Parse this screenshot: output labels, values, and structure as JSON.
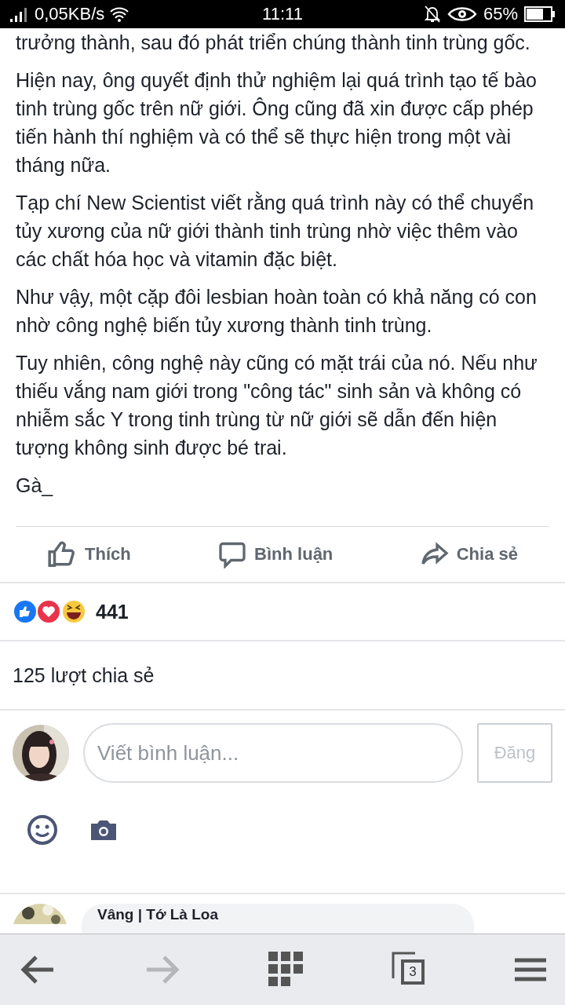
{
  "status_bar": {
    "speed": "0,05KB/s",
    "time": "11:11",
    "battery": "65%"
  },
  "article": {
    "paragraphs": [
      "trưởng thành, sau đó phát triển chúng thành tinh trùng gốc.",
      "Hiện nay, ông quyết định thử nghiệm lại quá trình tạo tế bào tinh trùng gốc trên nữ giới. Ông cũng đã xin được cấp phép tiến hành thí nghiệm và có thể sẽ thực hiện trong một vài tháng nữa.",
      "Tạp chí New Scientist viết rằng quá trình này có thể chuyển tủy xương của nữ giới thành tinh trùng nhờ việc thêm vào các chất hóa học và vitamin đặc biệt.",
      "Như vậy, một cặp đôi lesbian hoàn toàn có khả năng có con nhờ công nghệ biến tủy xương thành tinh trùng.",
      "Tuy nhiên, công nghệ này cũng có mặt trái của nó. Nếu như thiếu vắng nam giới trong \"công tác\" sinh sản và không có nhiễm sắc Y trong tinh trùng từ nữ giới sẽ dẫn đến hiện tượng không sinh được bé trai.",
      "Gà_"
    ]
  },
  "actions": [
    {
      "kind": "like",
      "label": "Thích"
    },
    {
      "kind": "comment",
      "label": "Bình luận"
    },
    {
      "kind": "share",
      "label": "Chia sẻ"
    }
  ],
  "reactions": {
    "count": "441"
  },
  "shares": "125 lượt chia sẻ",
  "composer": {
    "placeholder": "Viết bình luận...",
    "post_button": "Đăng",
    "disabled": true
  },
  "comment": {
    "author": "Vâng | Tớ Là Loa"
  },
  "bottom_bar": {
    "tabs_count": "3"
  }
}
